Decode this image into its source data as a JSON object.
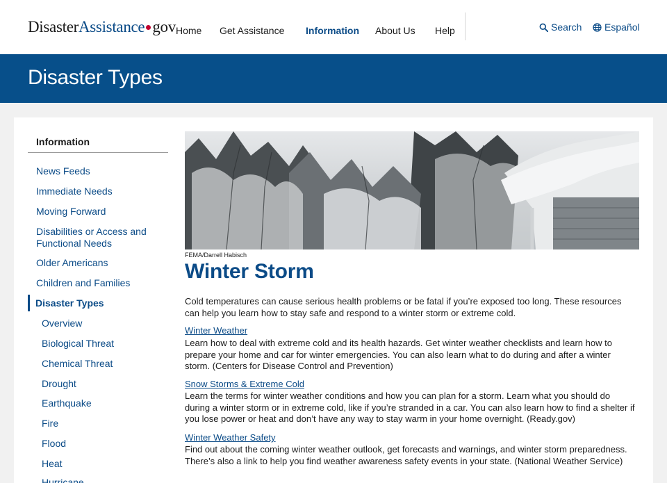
{
  "header": {
    "logo_part1": "Disaster",
    "logo_part2": "Assistance",
    "logo_part3": "gov",
    "nav": [
      "Home",
      "Get Assistance",
      "Information",
      "About Us",
      "Help"
    ],
    "active_nav": "Information",
    "search_label": "Search",
    "language_label": "Español"
  },
  "banner": {
    "title": "Disaster Types"
  },
  "sidebar": {
    "title": "Information",
    "items": [
      "News Feeds",
      "Immediate Needs",
      "Moving Forward",
      "Disabilities or Access and Functional Needs",
      "Older Americans",
      "Children and Families",
      "Disaster Types"
    ],
    "current": "Disaster Types",
    "subitems": [
      "Overview",
      "Biological Threat",
      "Chemical Threat",
      "Drought",
      "Earthquake",
      "Fire",
      "Flood",
      "Heat",
      "Hurricane"
    ]
  },
  "main": {
    "image_credit": "FEMA/Darrell Habisch",
    "title": "Winter Storm",
    "intro": "Cold temperatures can cause serious health problems or be fatal if you’re exposed too long. These resources can help you learn how to stay safe and respond to a winter storm or extreme cold.",
    "resources": [
      {
        "link": "Winter Weather",
        "text": "Learn how to deal with extreme cold and its health hazards. Get winter weather checklists and learn how to prepare your home and car for winter emergencies. You can also learn what to do during and after a winter storm. (Centers for Disease Control and Prevention)"
      },
      {
        "link": "Snow Storms & Extreme Cold",
        "text": "Learn the terms for winter weather conditions and how you can plan for a storm. Learn what you should do during a winter storm or in extreme cold, like if you’re stranded in a car. You can also learn how to find a shelter if you lose power or heat and don’t have any way to stay warm in your home overnight. (Ready.gov)"
      },
      {
        "link": "Winter Weather Safety",
        "text": "Find out about the coming winter weather outlook, get forecasts and warnings, and winter storm preparedness. There’s also a link to help you find weather awareness safety events in your state. (National Weather Service)"
      }
    ]
  },
  "colors": {
    "brand_blue": "#074f8a",
    "link_blue": "#0b4b87",
    "logo_dot": "#c2002f"
  }
}
